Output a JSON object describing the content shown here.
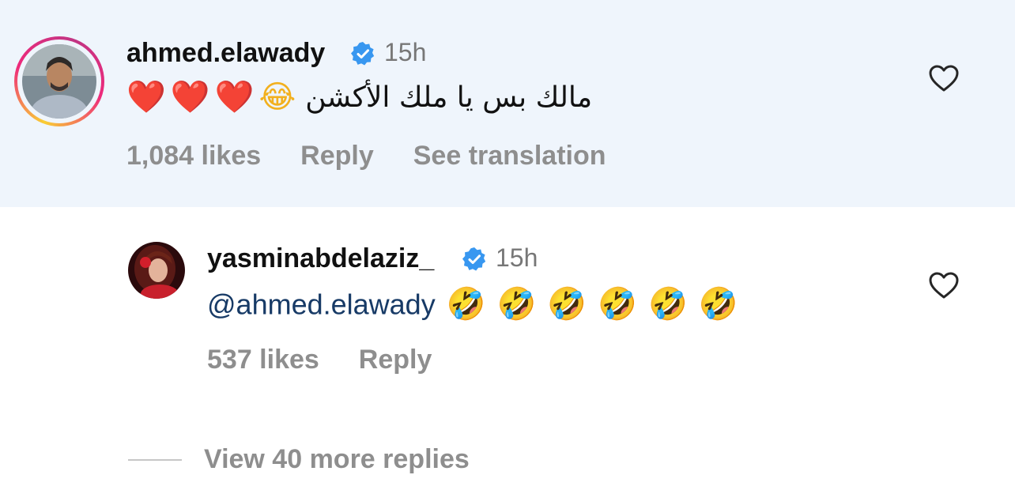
{
  "comments": [
    {
      "username": "ahmed.elawady",
      "verified": true,
      "time": "15h",
      "emojis": [
        "❤️",
        "❤️",
        "❤️",
        "😂"
      ],
      "text": "مالك بس يا ملك الأكشن",
      "likes": "1,084 likes",
      "reply_label": "Reply",
      "translate_label": "See translation",
      "highlight_bg": "#eff5fc"
    },
    {
      "username": "yasminabdelaziz_",
      "verified": true,
      "time": "15h",
      "mention": "@ahmed.elawady",
      "emojis": [
        "🤣",
        "🤣",
        "🤣",
        "🤣",
        "🤣",
        "🤣"
      ],
      "likes": "537 likes",
      "reply_label": "Reply"
    }
  ],
  "view_more": "View 40 more replies",
  "icons": {
    "verified": "verified-badge-icon",
    "like": "heart-outline-icon"
  },
  "colors": {
    "verified": "#3897f0",
    "mention": "#173a66",
    "meta": "#8e8e8e"
  }
}
